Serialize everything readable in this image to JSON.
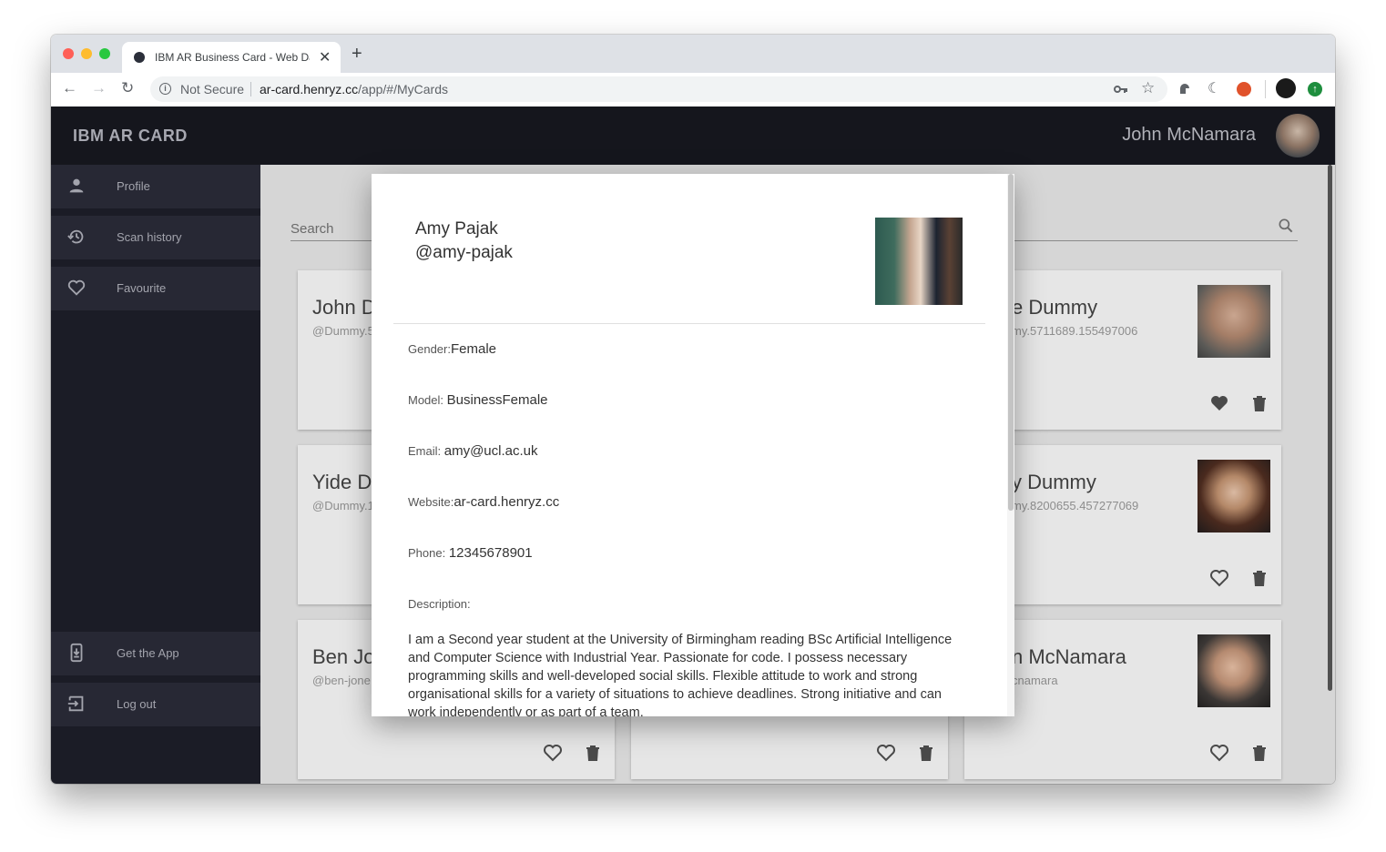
{
  "browser": {
    "tab_title": "IBM AR Business Card - Web Da",
    "not_secure": "Not Secure",
    "url_host": "ar-card.henryz.cc",
    "url_path": "/app/#/MyCards"
  },
  "app": {
    "brand": "IBM AR CARD",
    "user_name": "John McNamara"
  },
  "sidebar": {
    "items": [
      {
        "label": "Profile",
        "icon": "person-icon"
      },
      {
        "label": "Scan history",
        "icon": "history-icon"
      },
      {
        "label": "Favourite",
        "icon": "heart-outline-icon"
      }
    ],
    "bottom_items": [
      {
        "label": "Get the App",
        "icon": "download-app-icon"
      },
      {
        "label": "Log out",
        "icon": "logout-icon"
      }
    ]
  },
  "search": {
    "placeholder": "Search"
  },
  "cards": [
    {
      "name": "John D",
      "handle": "@Dummy.5"
    },
    {
      "name": "e Dummy",
      "handle": "my.5711689.155497006",
      "favourite": true
    },
    {
      "name": "Yide Du",
      "handle": "@Dummy.1"
    },
    {
      "name": "y Dummy",
      "handle": "my.8200655.457277069",
      "favourite": false
    },
    {
      "name": "Ben Jo",
      "handle": "@ben-jone"
    },
    {
      "name": "n McNamara",
      "handle": "cnamara",
      "favourite": false
    }
  ],
  "modal": {
    "name": "Amy Pajak",
    "handle": "@amy-pajak",
    "gender_label": "Gender:",
    "gender": "Female",
    "model_label": "Model: ",
    "model": "BusinessFemale",
    "email_label": "Email: ",
    "email": "amy@ucl.ac.uk",
    "website_label": "Website:",
    "website": "ar-card.henryz.cc",
    "phone_label": "Phone: ",
    "phone": "12345678901",
    "description_label": "Description:",
    "description": "I am a Second year student at the University of Birmingham reading BSc Artificial Intelligence and Computer Science with Industrial Year. Passionate for code. I possess necessary programming skills and well-developed social skills. Flexible attitude to work and strong organisational skills for a variety of situations to achieve deadlines. Strong initiative and can work independently or as part of a team."
  },
  "colors": {
    "appbar": "#15161d",
    "sidebar": "#1b1c26",
    "sidebar_item": "#272834",
    "content_bg": "#d6d6d6"
  }
}
